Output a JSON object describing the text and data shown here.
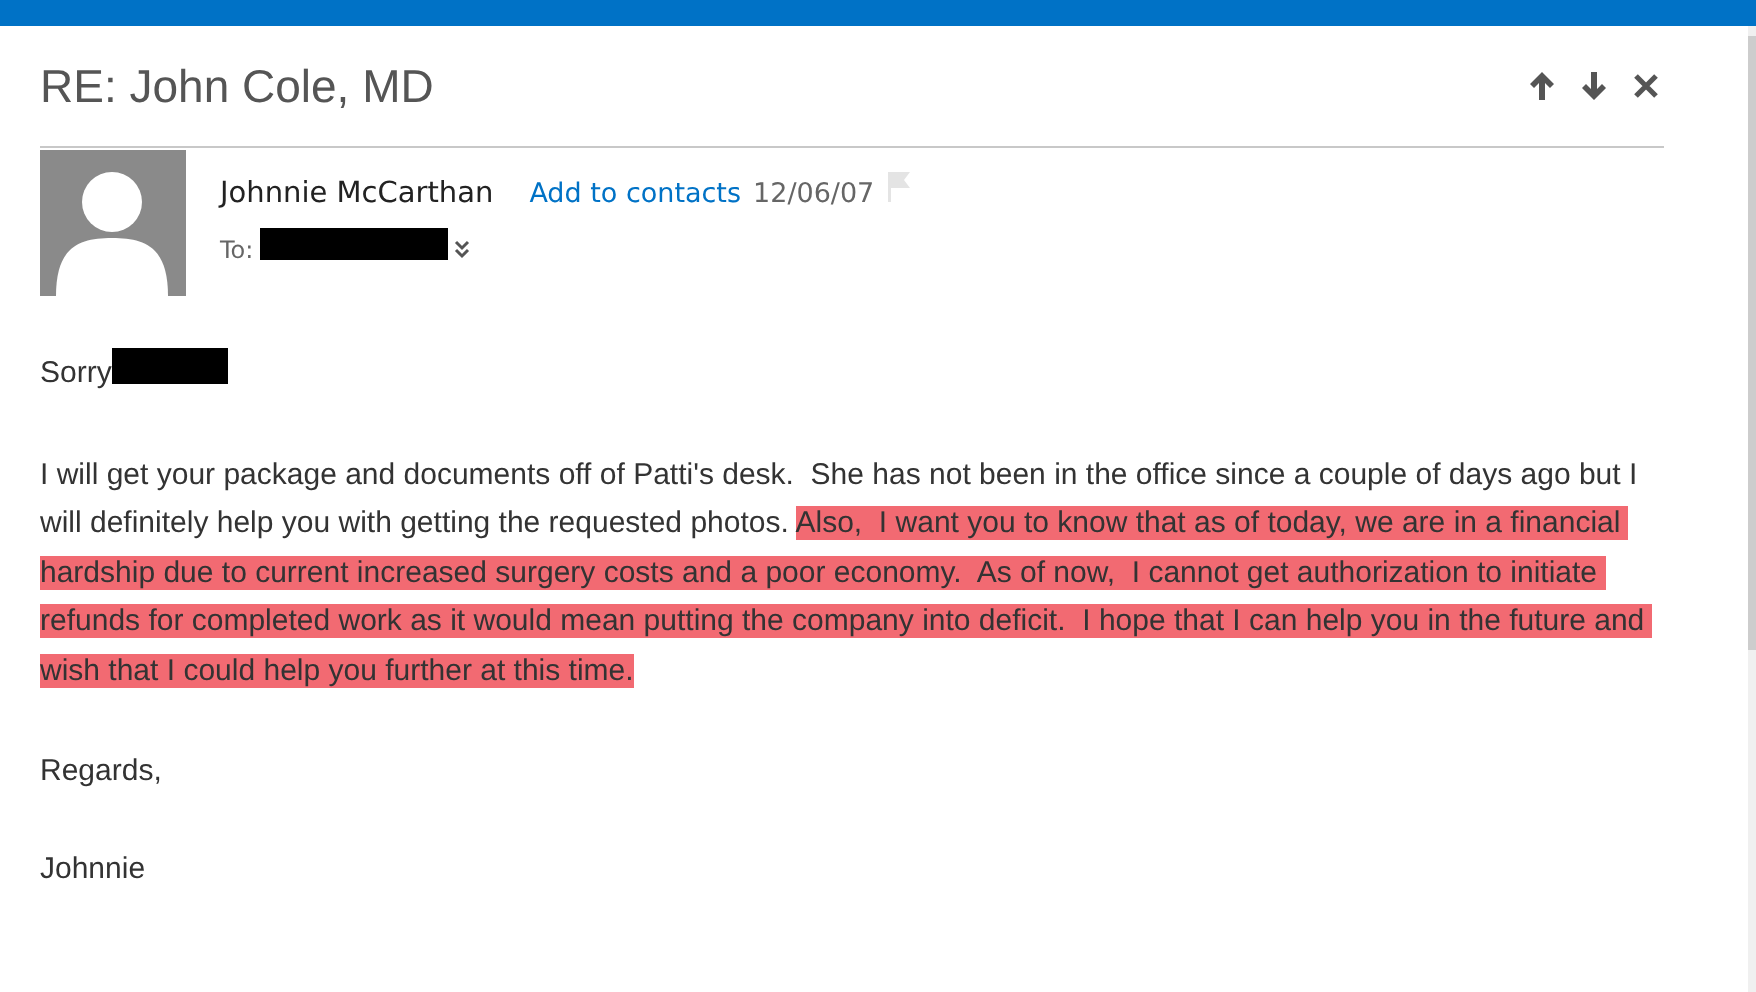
{
  "message": {
    "subject": "RE: John Cole, MD",
    "sender": "Johnnie McCarthan",
    "add_contact": "Add to contacts",
    "date": "12/06/07",
    "flagged": false,
    "to": {
      "label": "To:",
      "redacted": true
    },
    "greeting": {
      "text": "Sorry",
      "redacted": true
    },
    "paragraphs": [
      [
        {
          "text": "I will get your package and documents off of Patti's desk.  She has not been in the office since a couple of days ago but I will definitely help you with getting the requested photos. ",
          "highlighted": false
        },
        {
          "text": "Also,  I want you to know that as of today, we are in a financial hardship due to current increased surgery costs and a poor economy.  As of now,  I cannot get authorization to initiate refunds for completed work as it would mean putting the company into deficit.  I hope that I can help you in the future and wish that I could help you further at this time.",
          "highlighted": true
        }
      ],
      [
        {
          "text": "Regards,",
          "highlighted": false
        }
      ],
      [
        {
          "text": "Johnnie",
          "highlighted": false
        }
      ]
    ]
  }
}
